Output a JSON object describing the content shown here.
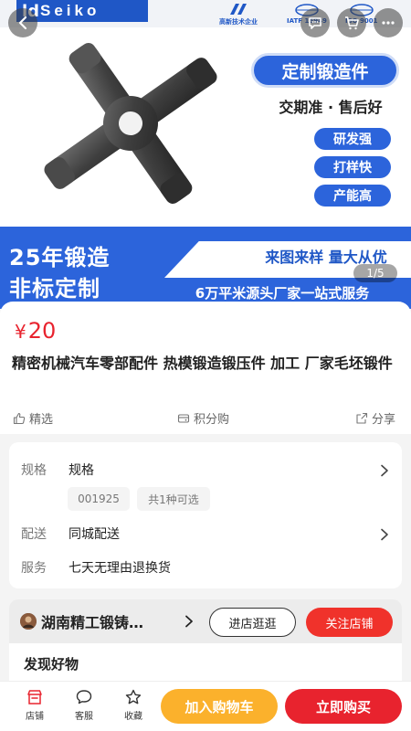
{
  "hero": {
    "brand_mark": "ld",
    "brand_name": "Seiko",
    "certs": [
      {
        "text": "高新技术企业"
      },
      {
        "text": "IATF 16949"
      },
      {
        "text": "ISO 9001"
      }
    ],
    "main_pill": "定制锻造件",
    "tagline": "交期准 · 售后好",
    "feature_pills": [
      "研发强",
      "打样快",
      "产能高"
    ],
    "big_line1": "25年锻造",
    "big_line2": "非标定制",
    "right_line1": "来图来样 量大从优",
    "right_line2": "6万平米源头厂家一站式服务",
    "counter": "1/5"
  },
  "top_buttons": {
    "back_icon": "back-arrow-icon",
    "chat_icon": "chat-icon",
    "cart_icon": "cart-icon",
    "more_icon": "more-icon"
  },
  "product": {
    "currency": "¥",
    "price": "20",
    "title": "精密机械汽车零部配件 热模锻造锻压件 加工 厂家毛坯锻件",
    "actions": [
      {
        "label": "精选",
        "icon": "thumbs-up-icon"
      },
      {
        "label": "积分购",
        "icon": "points-icon"
      },
      {
        "label": "分享",
        "icon": "share-icon"
      }
    ]
  },
  "spec": {
    "spec_label": "规格",
    "spec_value": "规格",
    "chips": [
      "001925",
      "共1种可选"
    ],
    "delivery_label": "配送",
    "delivery_value": "同城配送",
    "service_label": "服务",
    "service_value": "七天无理由退换货"
  },
  "shop": {
    "name": "湖南精工锻铸…",
    "visit_label": "进店逛逛",
    "follow_label": "关注店铺"
  },
  "discover": {
    "title": "发现好物"
  },
  "tabbar": {
    "tabs": [
      {
        "label": "店铺",
        "icon": "store-icon"
      },
      {
        "label": "客服",
        "icon": "chat-bubble-icon"
      },
      {
        "label": "收藏",
        "icon": "star-icon"
      }
    ],
    "cart_label": "加入购物车",
    "buy_label": "立即购买"
  },
  "colors": {
    "brand_blue": "#2c64db",
    "price_red": "#e8232e",
    "cart_orange": "#fbb12c",
    "follow_red": "#f0322b"
  }
}
